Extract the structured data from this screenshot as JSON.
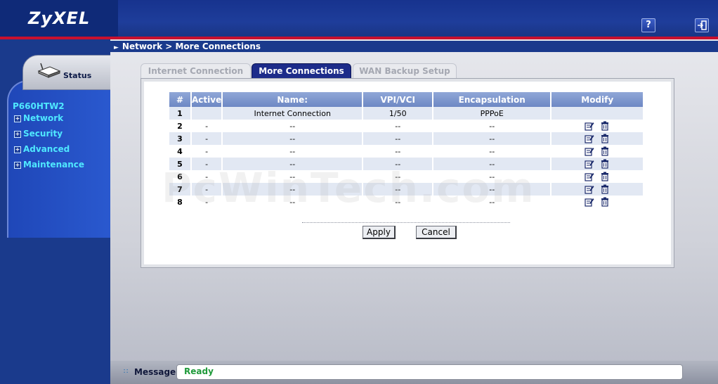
{
  "header": {
    "logo_text": "ZyXEL",
    "help_icon": "help-icon",
    "logout_icon": "logout-icon"
  },
  "sidebar": {
    "status_label": "Status",
    "device_model": "P660HTW2",
    "items": [
      {
        "label": "Network"
      },
      {
        "label": "Security"
      },
      {
        "label": "Advanced"
      },
      {
        "label": "Maintenance"
      }
    ]
  },
  "breadcrumb": "Network > More Connections",
  "tabs": [
    {
      "label": "Internet Connection",
      "active": false
    },
    {
      "label": "More Connections",
      "active": true
    },
    {
      "label": "WAN Backup Setup",
      "active": false
    }
  ],
  "table": {
    "headers": [
      "#",
      "Active",
      "Name:",
      "VPI/VCI",
      "Encapsulation",
      "Modify"
    ],
    "rows": [
      {
        "num": "1",
        "active": "",
        "name": "Internet Connection",
        "vpivci": "1/50",
        "encap": "PPPoE",
        "modify": false
      },
      {
        "num": "2",
        "active": "-",
        "name": "--",
        "vpivci": "--",
        "encap": "--",
        "modify": true
      },
      {
        "num": "3",
        "active": "-",
        "name": "--",
        "vpivci": "--",
        "encap": "--",
        "modify": true
      },
      {
        "num": "4",
        "active": "-",
        "name": "--",
        "vpivci": "--",
        "encap": "--",
        "modify": true
      },
      {
        "num": "5",
        "active": "-",
        "name": "--",
        "vpivci": "--",
        "encap": "--",
        "modify": true
      },
      {
        "num": "6",
        "active": "-",
        "name": "--",
        "vpivci": "--",
        "encap": "--",
        "modify": true
      },
      {
        "num": "7",
        "active": "-",
        "name": "--",
        "vpivci": "--",
        "encap": "--",
        "modify": true
      },
      {
        "num": "8",
        "active": "-",
        "name": "--",
        "vpivci": "--",
        "encap": "--",
        "modify": true
      }
    ]
  },
  "buttons": {
    "apply": "Apply",
    "cancel": "Cancel"
  },
  "status_bar": {
    "label": "Message",
    "text": "Ready"
  },
  "watermark": "PcWinTech.com"
}
